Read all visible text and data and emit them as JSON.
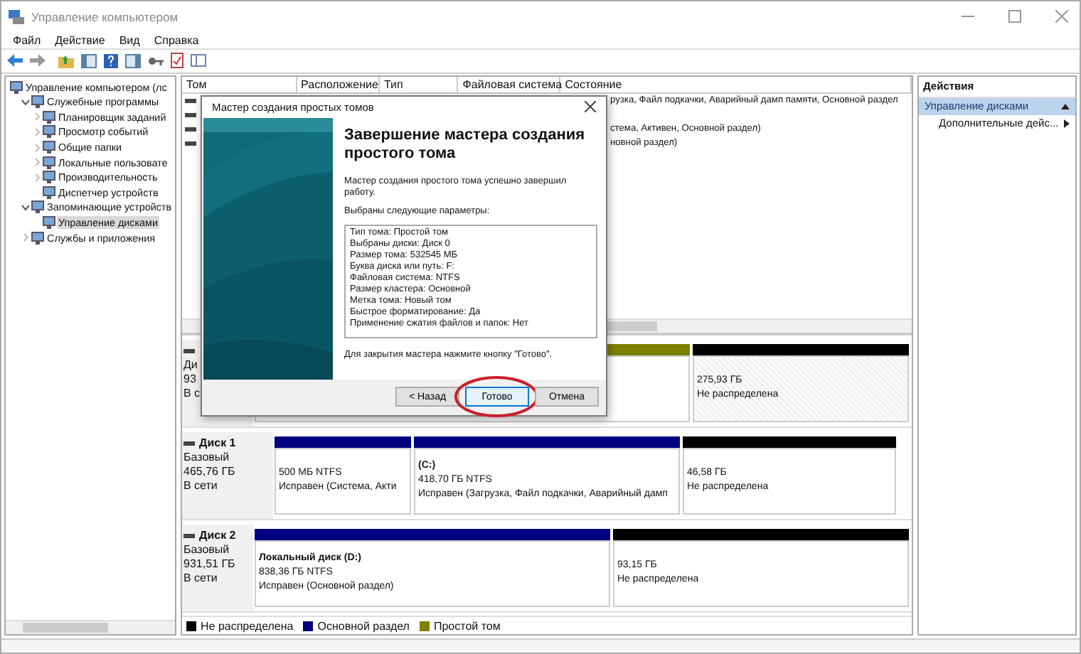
{
  "window": {
    "title": "Управление компьютером"
  },
  "menu": [
    "Файл",
    "Действие",
    "Вид",
    "Справка"
  ],
  "tree": [
    {
      "label": "Управление компьютером (лс",
      "selected": false,
      "children": [
        {
          "label": "Служебные программы",
          "expanded": true,
          "selected": false,
          "children": [
            {
              "label": "Планировщик заданий",
              "expanded": false,
              "selected": false
            },
            {
              "label": "Просмотр событий",
              "expanded": false,
              "selected": false
            },
            {
              "label": "Общие папки",
              "expanded": false,
              "selected": false
            },
            {
              "label": "Локальные пользовате",
              "expanded": false,
              "selected": false
            },
            {
              "label": "Производительность",
              "expanded": false,
              "selected": false
            },
            {
              "label": "Диспетчер устройств",
              "selected": false
            }
          ]
        },
        {
          "label": "Запоминающие устройств",
          "expanded": true,
          "selected": false,
          "children": [
            {
              "label": "Управление дисками",
              "selected": true
            }
          ]
        },
        {
          "label": "Службы и приложения",
          "expanded": false,
          "selected": false
        }
      ]
    }
  ],
  "volume_table": {
    "columns": [
      "Том",
      "Расположение",
      "Тип",
      "Файловая система",
      "Состояние"
    ],
    "rows": [
      {
        "status": "рузка, Файл подкачки, Аварийный дамп памяти, Основной раздел"
      },
      {},
      {
        "status": "стема, Активен, Основной раздел)"
      },
      {
        "status": "новной раздел)"
      }
    ]
  },
  "disks": [
    {
      "type": "Ди",
      "capacity": "93",
      "state": "В с",
      "partitions": [
        {
          "color": "#808000",
          "selected": false
        },
        {
          "color": "#000000",
          "selected": true,
          "size": "275,93 ГБ",
          "status": "Не распределена"
        }
      ]
    },
    {
      "name": "Диск 1",
      "type": "Базовый",
      "capacity": "465,76 ГБ",
      "state": "В сети",
      "partitions": [
        {
          "color": "#000080",
          "selected": false,
          "size": "500 МБ NTFS",
          "status": "Исправен (Система, Акти"
        },
        {
          "color": "#000080",
          "selected": false,
          "name": "(C:)",
          "size": "418,70 ГБ NTFS",
          "status": "Исправен (Загрузка, Файл подкачки, Аварийный дамп"
        },
        {
          "color": "#000000",
          "selected": false,
          "size": "46,58 ГБ",
          "status": "Не распределена"
        }
      ]
    },
    {
      "name": "Диск 2",
      "type": "Базовый",
      "capacity": "931,51 ГБ",
      "state": "В сети",
      "partitions": [
        {
          "color": "#000080",
          "selected": false,
          "name": "Локальный диск  (D:)",
          "size": "838,36 ГБ NTFS",
          "status": "Исправен (Основной раздел)"
        },
        {
          "color": "#000000",
          "selected": false,
          "size": "93,15 ГБ",
          "status": "Не распределена"
        }
      ]
    }
  ],
  "legend": [
    {
      "label": "Не распределена",
      "color": "#000000"
    },
    {
      "label": "Основной раздел",
      "color": "#000080"
    },
    {
      "label": "Простой том",
      "color": "#808000"
    }
  ],
  "actions": {
    "title": "Действия",
    "items": [
      {
        "label": "Управление дисками",
        "kind": "header"
      },
      {
        "label": "Дополнительные дейс...",
        "kind": "submenu"
      }
    ]
  },
  "dialog": {
    "title": "Мастер создания простых томов",
    "heading": "Завершение мастера создания простого тома",
    "message": "Мастер создания простого тома успешно завершил работу.",
    "params_label": "Выбраны следующие параметры:",
    "params": [
      "Тип тома: Простой том",
      "Выбраны диски: Диск 0",
      "Размер тома: 532545 МБ",
      "Буква диска или путь: F:",
      "Файловая система: NTFS",
      "Размер кластера: Основной",
      "Метка тома: Новый том",
      "Быстрое форматирование: Да",
      "Применение сжатия файлов и папок: Нет"
    ],
    "hint": "Для закрытия мастера нажмите кнопку \"Готово\".",
    "buttons": [
      {
        "label": "< Назад",
        "primary": false,
        "circled": false
      },
      {
        "label": "Готово",
        "primary": true,
        "circled": true
      },
      {
        "label": "Отмена",
        "primary": false,
        "circled": false
      }
    ]
  }
}
